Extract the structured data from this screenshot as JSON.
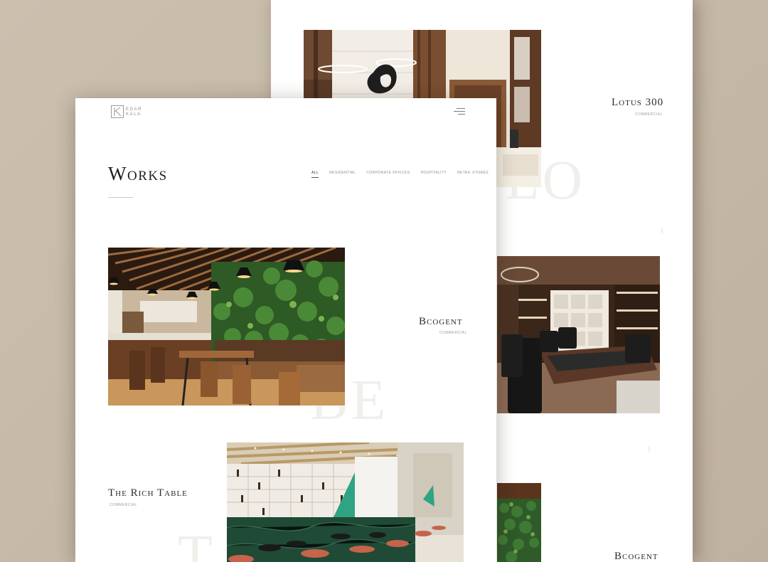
{
  "back_page": {
    "projects": [
      {
        "title": "Lotus 300",
        "category": "Commercial",
        "ghost": "LO"
      },
      {
        "title": "Bcogent",
        "category": ""
      }
    ],
    "marks": [
      "|",
      "|"
    ]
  },
  "front_page": {
    "logo": {
      "line1": "EDAR",
      "line2": "KALA"
    },
    "page_title": "Works",
    "filters": [
      "All",
      "Residential",
      "Corporate Offices",
      "Hospitality",
      "Retail Stores"
    ],
    "active_filter": "All",
    "projects": [
      {
        "title": "Bcogent",
        "category": "Commercial",
        "ghost": "BE"
      },
      {
        "title": "The Rich Table",
        "category": "Commercial",
        "ghost": "T"
      }
    ]
  },
  "colors": {
    "background": "#c9bcab",
    "page": "#ffffff",
    "text": "#2b2b2b",
    "muted": "#9b9b9b"
  },
  "icons": [
    "menu-icon",
    "logo-mark"
  ]
}
